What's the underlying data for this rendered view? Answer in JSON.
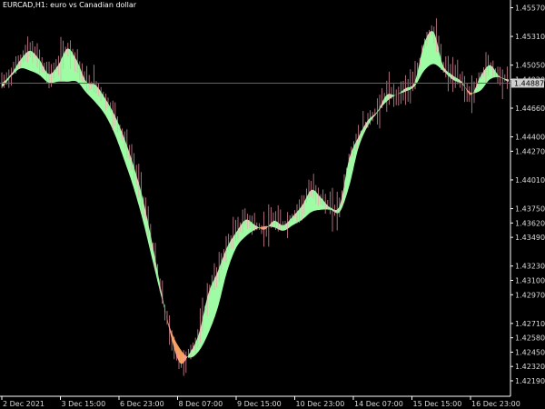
{
  "chart_data": {
    "type": "area",
    "title": "EURCAD,H1:  euro vs Canadian dollar",
    "current_price": "1.44887",
    "ylim": [
      1.4205,
      1.4564
    ],
    "y_ticks": [
      "1.45570",
      "1.45310",
      "1.45050",
      "1.44920",
      "1.44660",
      "1.44400",
      "1.44270",
      "1.44010",
      "1.43750",
      "1.43620",
      "1.43490",
      "1.43230",
      "1.43100",
      "1.42970",
      "1.42710",
      "1.42580",
      "1.42450",
      "1.42320",
      "1.42190"
    ],
    "x_ticks": [
      "2 Dec 2021",
      "3 Dec 15:00",
      "6 Dec 23:00",
      "8 Dec 07:00",
      "9 Dec 15:00",
      "10 Dec 23:00",
      "14 Dec 07:00",
      "15 Dec 15:00",
      "16 Dec 23:00"
    ],
    "colors": {
      "bull_fill": "#9dfca4",
      "bear_fill": "#f5a05f",
      "candle_up": "#ff9fb7",
      "candle_down": "#ff9fb7",
      "price_line": "#666666",
      "axis": "#ffffff"
    },
    "fast_line": [
      1.4489,
      1.4497,
      1.451,
      1.4518,
      1.451,
      1.4497,
      1.4505,
      1.452,
      1.4509,
      1.449,
      1.4487,
      1.4475,
      1.446,
      1.444,
      1.4415,
      1.4385,
      1.4345,
      1.43,
      1.426,
      1.4235,
      1.4244,
      1.4262,
      1.4298,
      1.4318,
      1.434,
      1.4354,
      1.4365,
      1.436,
      1.4356,
      1.4364,
      1.436,
      1.4368,
      1.4378,
      1.4392,
      1.4385,
      1.4376,
      1.4378,
      1.442,
      1.444,
      1.4455,
      1.4463,
      1.4478,
      1.4478,
      1.4484,
      1.449,
      1.4525,
      1.4535,
      1.4505,
      1.4496,
      1.449,
      1.4478,
      1.4495,
      1.4505,
      1.4495,
      1.4492
    ],
    "slow_line": [
      1.4485,
      1.4495,
      1.4502,
      1.45,
      1.4496,
      1.4489,
      1.449,
      1.449,
      1.449,
      1.448,
      1.4471,
      1.446,
      1.4443,
      1.442,
      1.4395,
      1.4365,
      1.433,
      1.4295,
      1.4265,
      1.4248,
      1.424,
      1.4246,
      1.4262,
      1.4285,
      1.4318,
      1.434,
      1.435,
      1.4356,
      1.4359,
      1.4358,
      1.4355,
      1.436,
      1.4365,
      1.4372,
      1.4374,
      1.4374,
      1.4372,
      1.4395,
      1.443,
      1.445,
      1.4462,
      1.4472,
      1.4478,
      1.4481,
      1.4486,
      1.45,
      1.4506,
      1.45,
      1.4492,
      1.4488,
      1.448,
      1.4482,
      1.4492,
      1.4494,
      1.449
    ]
  }
}
